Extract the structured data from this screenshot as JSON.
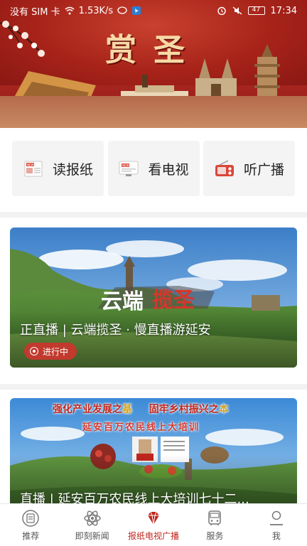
{
  "status_bar": {
    "carrier": "没有 SIM 卡",
    "speed": "1.53K/s",
    "battery": "47",
    "time": "17:34"
  },
  "hero": {
    "title": "赏圣"
  },
  "categories": [
    {
      "label": "读报纸",
      "icon": "newspaper-icon"
    },
    {
      "label": "看电视",
      "icon": "tv-news-icon"
    },
    {
      "label": "听广播",
      "icon": "radio-icon"
    }
  ],
  "feed": {
    "cards": [
      {
        "title": "正直播 | 云端揽圣 · 慢直播游延安",
        "badge": "进行中",
        "overlay_text": "云端揽圣"
      },
      {
        "title": "直播 | 延安百万农民线上大培训七十二...",
        "banner_line1_a": "强化产业发展之",
        "banner_line1_b": "基",
        "banner_line1_c": "固牢乡村振兴之",
        "banner_line1_d": "本",
        "banner_line2": "延安百万农民线上大培训"
      }
    ]
  },
  "bottom_nav": [
    {
      "label": "推荐",
      "icon": "recommend-icon",
      "active": false
    },
    {
      "label": "即刻新闻",
      "icon": "atom-icon",
      "active": false
    },
    {
      "label": "报纸电视广播",
      "icon": "diamond-icon",
      "active": true
    },
    {
      "label": "服务",
      "icon": "bus-icon",
      "active": false
    },
    {
      "label": "我",
      "icon": "profile-icon",
      "active": false
    }
  ],
  "colors": {
    "accent": "#c0261d",
    "hero_red": "#a72319",
    "title_gold": "#f7d9a6"
  }
}
